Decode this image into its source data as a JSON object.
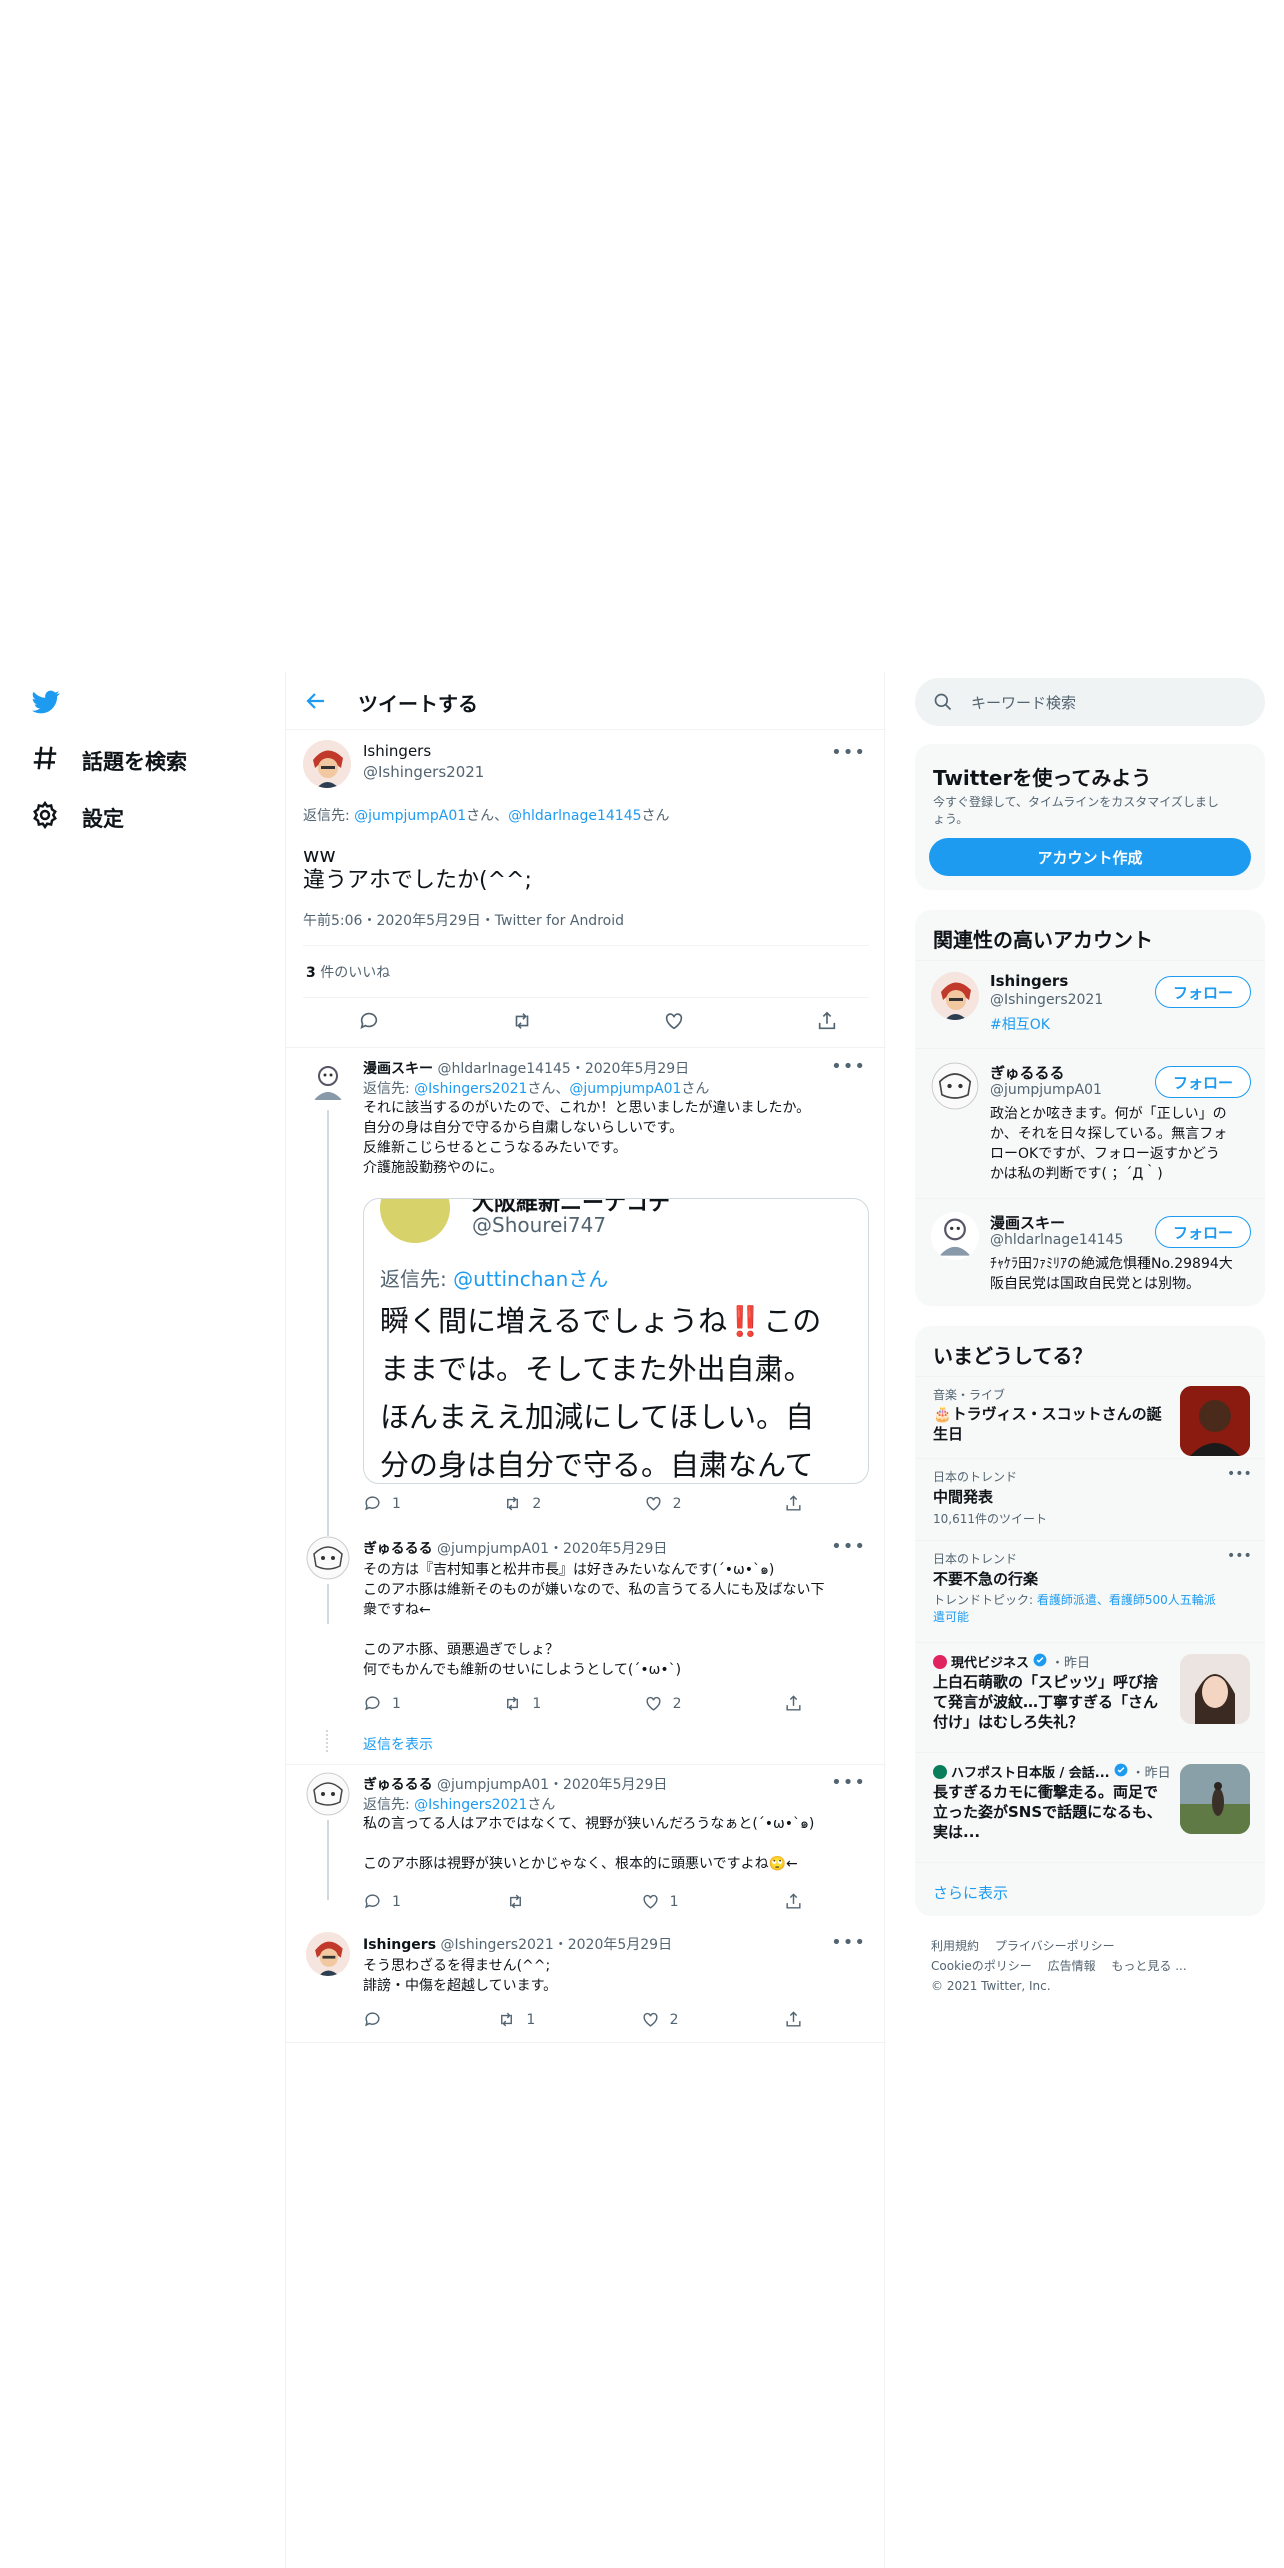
{
  "nav": {
    "explore_label": "話題を検索",
    "settings_label": "設定"
  },
  "header": {
    "title": "ツイートする"
  },
  "main_tweet": {
    "name": "Ishingers",
    "handle": "@Ishingers2021",
    "reply_prefix": "返信先: ",
    "reply_to_1": "@jumpjumpA01",
    "reply_mid": "さん、",
    "reply_to_2": "@hldarlnage14145",
    "reply_suffix": "さん",
    "text_line1": "ww",
    "text_line2": "違うアホでしたか(^^;",
    "meta": "午前5:06・2020年5月29日・Twitter for Android",
    "likes_count": "3",
    "likes_label": "件のいいね"
  },
  "replies": [
    {
      "name": "漫画スキー",
      "handle_date": "@hldarlnage14145・2020年5月29日",
      "reply_prefix": "返信先: ",
      "reply_to_1": "@Ishingers2021",
      "reply_mid": "さん、",
      "reply_to_2": "@jumpjumpA01",
      "reply_suffix": "さん",
      "lines": [
        "それに該当するのがいたので、これか！と思いましたが違いましたか。",
        "自分の身は自分で守るから自粛しないらしいです。",
        "反維新こじらせるとこうなるみたいです。",
        "介護施設勤務やのに。"
      ],
      "quote": {
        "name_partial": "大阪維新ニーナコテ",
        "handle": "@Shourei747",
        "reply_prefix": "返信先: ",
        "reply_to": "@uttinchan",
        "reply_suffix": "さん",
        "lines": [
          "瞬く間に増えるでしょうね‼️この",
          "ままでは。そしてまた外出自粛。",
          "ほんまええ加減にしてほしい。自",
          "分の身は自分で守る。自粛なんて"
        ]
      },
      "counts": {
        "reply": "1",
        "retweet": "2",
        "like": "2"
      }
    },
    {
      "name": "ぎゅるるる",
      "handle_date": "@jumpjumpA01・2020年5月29日",
      "lines": [
        "その方は『吉村知事と松井市長』は好きみたいなんです(´•ω•`๑)",
        "このアホ豚は維新そのものが嫌いなので、私の言うてる人にも及ばない下",
        "衆ですね←",
        "",
        "このアホ豚、頭悪過ぎでしょ？",
        "何でもかんでも維新のせいにしようとして(´•ω•`)"
      ],
      "counts": {
        "reply": "1",
        "retweet": "1",
        "like": "2"
      },
      "show_replies": "返信を表示"
    },
    {
      "name": "ぎゅるるる",
      "handle_date": "@jumpjumpA01・2020年5月29日",
      "reply_prefix": "返信先: ",
      "reply_to_1": "@Ishingers2021",
      "reply_suffix": "さん",
      "lines": [
        "私の言ってる人はアホではなくて、視野が狭いんだろうなぁと(´•ω•`๑)",
        "",
        "このアホ豚は視野が狭いとかじゃなく、根本的に頭悪いですよね🙄←"
      ],
      "counts": {
        "reply": "1",
        "retweet": "",
        "like": "1"
      }
    },
    {
      "name": "Ishingers",
      "handle_date": "@Ishingers2021・2020年5月29日",
      "lines": [
        "そう思わざるを得ません(^^;",
        "誹謗・中傷を超越しています。"
      ],
      "counts": {
        "reply": "",
        "retweet": "1",
        "like": "2"
      }
    }
  ],
  "search": {
    "placeholder": "キーワード検索"
  },
  "signup": {
    "title": "Twitterを使ってみよう",
    "desc_line1": "今すぐ登録して、タイムラインをカスタマイズしまし",
    "desc_line2": "ょう。",
    "button": "アカウント作成"
  },
  "related": {
    "title": "関連性の高いアカウント",
    "follow_label": "フォロー",
    "accounts": [
      {
        "name": "Ishingers",
        "handle": "@Ishingers2021",
        "bio": [
          "#相互OK"
        ]
      },
      {
        "name": "ぎゅるるる",
        "handle": "@jumpjumpA01",
        "bio": [
          "政治とか呟きます。何が「正しい」の",
          "か、それを日々探している。無言フォ",
          "ローOKですが、フォロー返すかどう",
          "かは私の判断です( ；´Д｀)"
        ]
      },
      {
        "name": "漫画スキー",
        "handle": "@hldarlnage14145",
        "bio": [
          "ﾁｬｹﾗ田ﾌｧﾐﾘｱの絶滅危惧種No.29894大",
          "阪自民党は国政自民党とは別物。"
        ]
      }
    ]
  },
  "trends": {
    "title": "いまどうしてる？",
    "items": [
      {
        "category": "音楽・ライブ",
        "title_line1": "🎂トラヴィス・スコットさんの誕",
        "title_line2": "生日"
      },
      {
        "category": "日本のトレンド",
        "title": "中間発表",
        "sub": "10,611件のツイート"
      },
      {
        "category": "日本のトレンド",
        "title": "不要不急の行楽",
        "sub_prefix": "トレンドトピック: ",
        "sub_link_line1": "看護師派遣、看護師500人五輪派",
        "sub_link_line2": "遣可能"
      },
      {
        "source": "現代ビジネス",
        "time": "・昨日",
        "lines": [
          "上白石萌歌の「スピッツ」呼び捨",
          "て発言が波紋…丁寧すぎる「さん",
          "付け」はむしろ失礼？"
        ]
      },
      {
        "source": "ハフポスト日本版 / 会話...",
        "time": "・昨日",
        "lines": [
          "長すぎるカモに衝撃走る。両足で",
          "立った姿がSNSで話題になるも、",
          "実は..."
        ]
      }
    ],
    "show_more": "さらに表示"
  },
  "footer": {
    "line1": [
      "利用規約",
      "プライバシーポリシー"
    ],
    "line2": [
      "Cookieのポリシー",
      "広告情報",
      "もっと見る ..."
    ],
    "copyright": "© 2021 Twitter, Inc."
  },
  "colors": {
    "accent": "#1d9bf0",
    "text": "#0f1419",
    "secondary": "#536471",
    "panel": "#f7f9f9",
    "border": "#eff3f4"
  }
}
